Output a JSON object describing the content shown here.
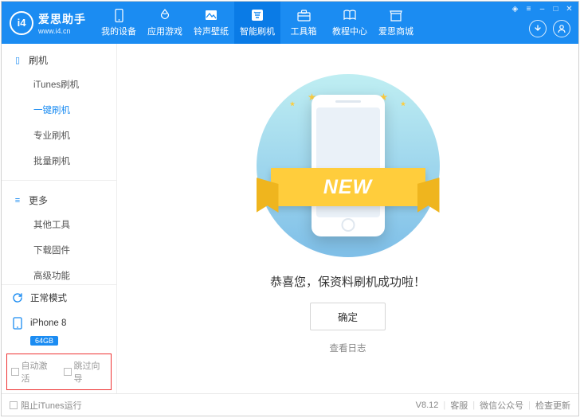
{
  "header": {
    "title": "爱思助手",
    "subtitle": "www.i4.cn",
    "nav": [
      "我的设备",
      "应用游戏",
      "铃声壁纸",
      "智能刷机",
      "工具箱",
      "教程中心",
      "爱思商城"
    ]
  },
  "sidebar": {
    "flash": {
      "header": "刷机",
      "items": [
        "iTunes刷机",
        "一键刷机",
        "专业刷机",
        "批量刷机"
      ]
    },
    "more": {
      "header": "更多",
      "items": [
        "其他工具",
        "下载固件",
        "高级功能"
      ]
    },
    "mode": "正常模式",
    "device": {
      "name": "iPhone 8",
      "storage": "64GB"
    },
    "options": [
      "自动激活",
      "跳过向导"
    ]
  },
  "main": {
    "ribbon": "NEW",
    "message": "恭喜您，保资料刷机成功啦！",
    "confirm": "确定",
    "view_log": "查看日志"
  },
  "status": {
    "block_itunes": "阻止iTunes运行",
    "version": "V8.12",
    "support": "客服",
    "wechat": "微信公众号",
    "update": "检查更新"
  }
}
